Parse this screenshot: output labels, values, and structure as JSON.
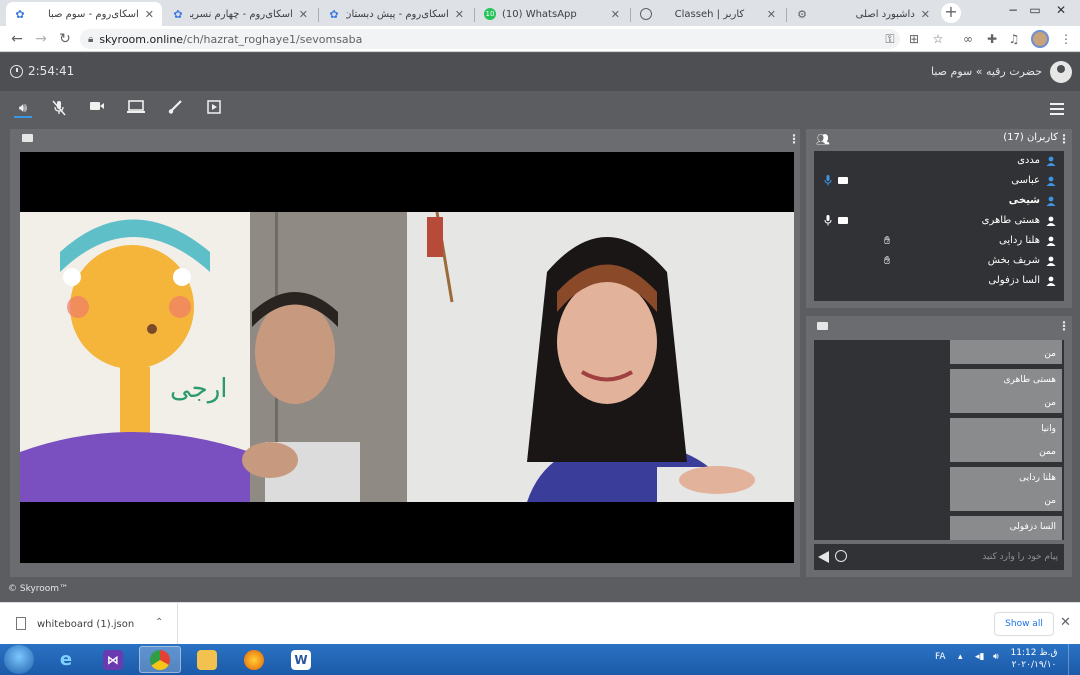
{
  "browser": {
    "tabs": [
      {
        "title": "اسکای‌روم - سوم صبا",
        "active": true,
        "icon": "skyroom-icon"
      },
      {
        "title": "اسکای‌روم - چهارم نسرین",
        "active": false,
        "icon": "skyroom-icon"
      },
      {
        "title": "اسکای‌روم - پیش دبستان دنیا",
        "active": false,
        "icon": "skyroom-icon"
      },
      {
        "title": "(10) WhatsApp",
        "active": false,
        "icon": "whatsapp-icon"
      },
      {
        "title": "Classeh | کاربر",
        "active": false,
        "icon": "globe-icon"
      },
      {
        "title": "داشبورد اصلی",
        "active": false,
        "icon": "gear-icon"
      }
    ],
    "new_tab": "+",
    "url_host": "skyroom.online",
    "url_path": "/ch/hazrat_roghaye1/sevomsaba"
  },
  "app": {
    "timer": "2:54:41",
    "room_title": "حضرت رقیه » سوم صبا"
  },
  "users": {
    "title": "کاربران (17)",
    "list": [
      {
        "name": "مددی",
        "role": "presenter",
        "mic": false,
        "cam": false,
        "hand": false,
        "bold": false
      },
      {
        "name": "عباسی",
        "role": "presenter",
        "mic": true,
        "cam": true,
        "hand": false,
        "bold": false
      },
      {
        "name": "شیخی",
        "role": "presenter",
        "mic": false,
        "cam": false,
        "hand": false,
        "bold": true
      },
      {
        "name": "هستی طاهری",
        "role": "user",
        "mic": true,
        "cam": true,
        "hand": false,
        "bold": false
      },
      {
        "name": "هلنا ردایی",
        "role": "user",
        "mic": false,
        "cam": false,
        "hand": true,
        "bold": false
      },
      {
        "name": "شریف بخش",
        "role": "user",
        "mic": false,
        "cam": false,
        "hand": true,
        "bold": false
      },
      {
        "name": "السا دزفولی",
        "role": "user",
        "mic": false,
        "cam": false,
        "hand": false,
        "bold": false
      }
    ],
    "colors": {
      "presenter": "#3d95e6",
      "user": "#ffffff"
    }
  },
  "chat": {
    "messages": [
      {
        "sender": "",
        "text": "من"
      },
      {
        "sender": "هستی طاهری",
        "text": "من"
      },
      {
        "sender": "وانیا",
        "text": "ممن"
      },
      {
        "sender": "هلنا ردایی",
        "text": "من"
      },
      {
        "sender": "السا دزفولی",
        "text": ""
      }
    ],
    "input_placeholder": "پیام خود را وارد کنید"
  },
  "footer": {
    "copyright": "© Skyroom™"
  },
  "downloads": {
    "file_name": "whiteboard (1).json",
    "show_all": "Show all"
  },
  "taskbar": {
    "lang": "FA",
    "time": "11:12 ق.ظ",
    "date": "۲۰۲۰/۱۹/۱۰"
  }
}
